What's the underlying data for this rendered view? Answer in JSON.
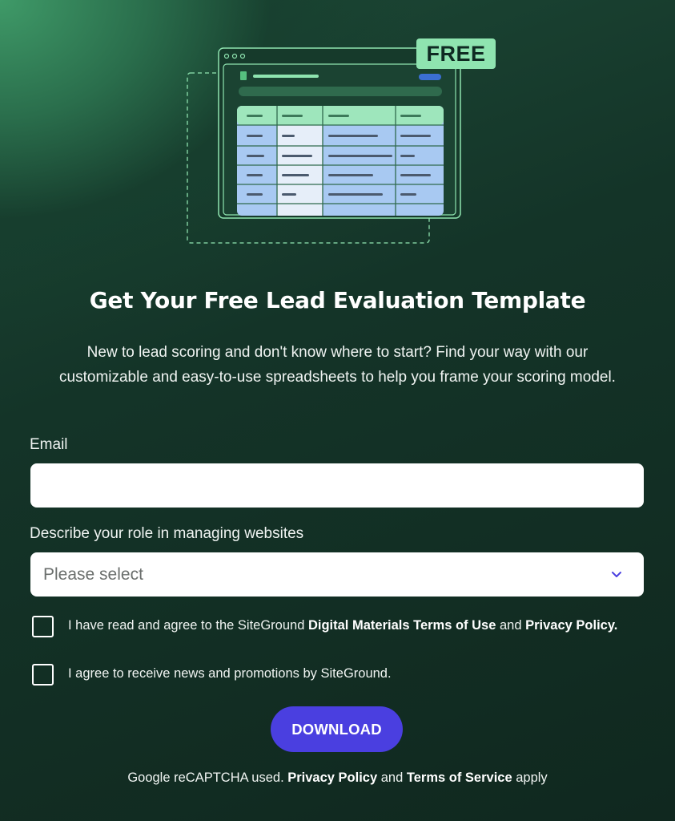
{
  "illustration": {
    "badge": "FREE",
    "icon": "spreadsheet-icon"
  },
  "colors": {
    "accent_button": "#4a3fe0",
    "badge_bg": "#8fe4b0",
    "background_dark": "#10281f",
    "background_glow": "#3f9a68",
    "chevron": "#4a3fe0"
  },
  "heading": "Get Your Free Lead Evaluation Template",
  "intro": "New to lead scoring and don't know where to start? Find your way with our customizable and easy-to-use spreadsheets to help you frame your scoring model.",
  "form": {
    "email_label": "Email",
    "email_value": "",
    "role_label": "Describe your role in managing websites",
    "role_placeholder": "Please select",
    "terms": {
      "prefix": "I have read and agree to the SiteGround ",
      "link1": "Digital Materials Terms of Use",
      "middle": " and ",
      "link2": "Privacy Policy."
    },
    "news": "I agree to receive news and promotions by SiteGround.",
    "submit": "DOWNLOAD"
  },
  "footer": {
    "prefix": "Google reCAPTCHA used. ",
    "link1": "Privacy Policy",
    "middle": " and ",
    "link2": "Terms of Service",
    "suffix": " apply"
  }
}
